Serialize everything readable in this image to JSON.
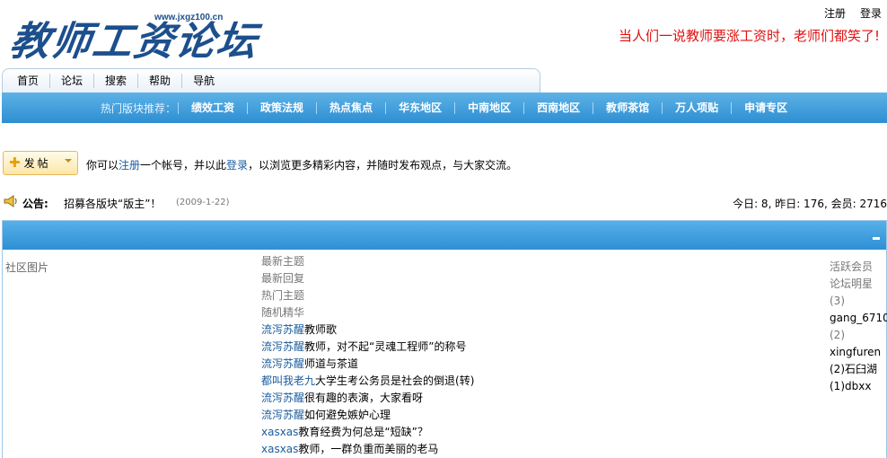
{
  "header": {
    "logo_text": "教师工资论坛",
    "logo_url": "www.jxgz100.cn",
    "register": "注册",
    "login": "登录",
    "slogan": "当人们一说教师要涨工资时，老师们都笑了!"
  },
  "nav": [
    "首页",
    "论坛",
    "搜索",
    "帮助",
    "导航"
  ],
  "hot": {
    "label": "热门版块推荐：",
    "items": [
      "绩效工资",
      "政策法规",
      "热点焦点",
      "华东地区",
      "中南地区",
      "西南地区",
      "教师茶馆",
      "万人项贴",
      "申请专区"
    ]
  },
  "post": {
    "button_label": "发帖",
    "msg_prefix": "你可以",
    "msg_register": "注册",
    "msg_middle": "一个帐号，并以此",
    "msg_login": "登录",
    "msg_suffix": "，以浏览更多精彩内容，并随时发布观点，与大家交流。"
  },
  "announcement": {
    "label": "公告:",
    "text": "招募各版块“版主”！",
    "date": "(2009-1-22)"
  },
  "stats": "今日: 8, 昨日: 176, 会员: 2716",
  "box": {
    "pictures_label": "社区图片",
    "tabs": [
      "最新主题",
      "最新回复",
      "热门主题",
      "随机精华"
    ],
    "threads": [
      {
        "author": "流泻苏醒",
        "title": "教师歌"
      },
      {
        "author": "流泻苏醒",
        "title": "教师，对不起“灵魂工程师”的称号"
      },
      {
        "author": "流泻苏醒",
        "title": "师道与茶道"
      },
      {
        "author": "都叫我老九",
        "title": "大学生考公务员是社会的倒退(转)"
      },
      {
        "author": "流泻苏醒",
        "title": "很有趣的表演，大家看呀"
      },
      {
        "author": "流泻苏醒",
        "title": "如何避免嫉妒心理"
      },
      {
        "author": "xasxas",
        "title": "教育经费为何总是“短缺”？"
      },
      {
        "author": "xasxas",
        "title": "教师，一群负重而美丽的老马"
      }
    ],
    "right": {
      "active_label": "活跃会员",
      "stars_label": "论坛明星",
      "rows": [
        "(3)",
        "gang_6710",
        "(2)",
        "xingfuren",
        "(2)石臼湖",
        "(1)dbxx"
      ]
    }
  },
  "colors": {
    "accent_blue": "#2e8fd4",
    "link": "#1a5c9e",
    "slogan_red": "#e01010"
  }
}
